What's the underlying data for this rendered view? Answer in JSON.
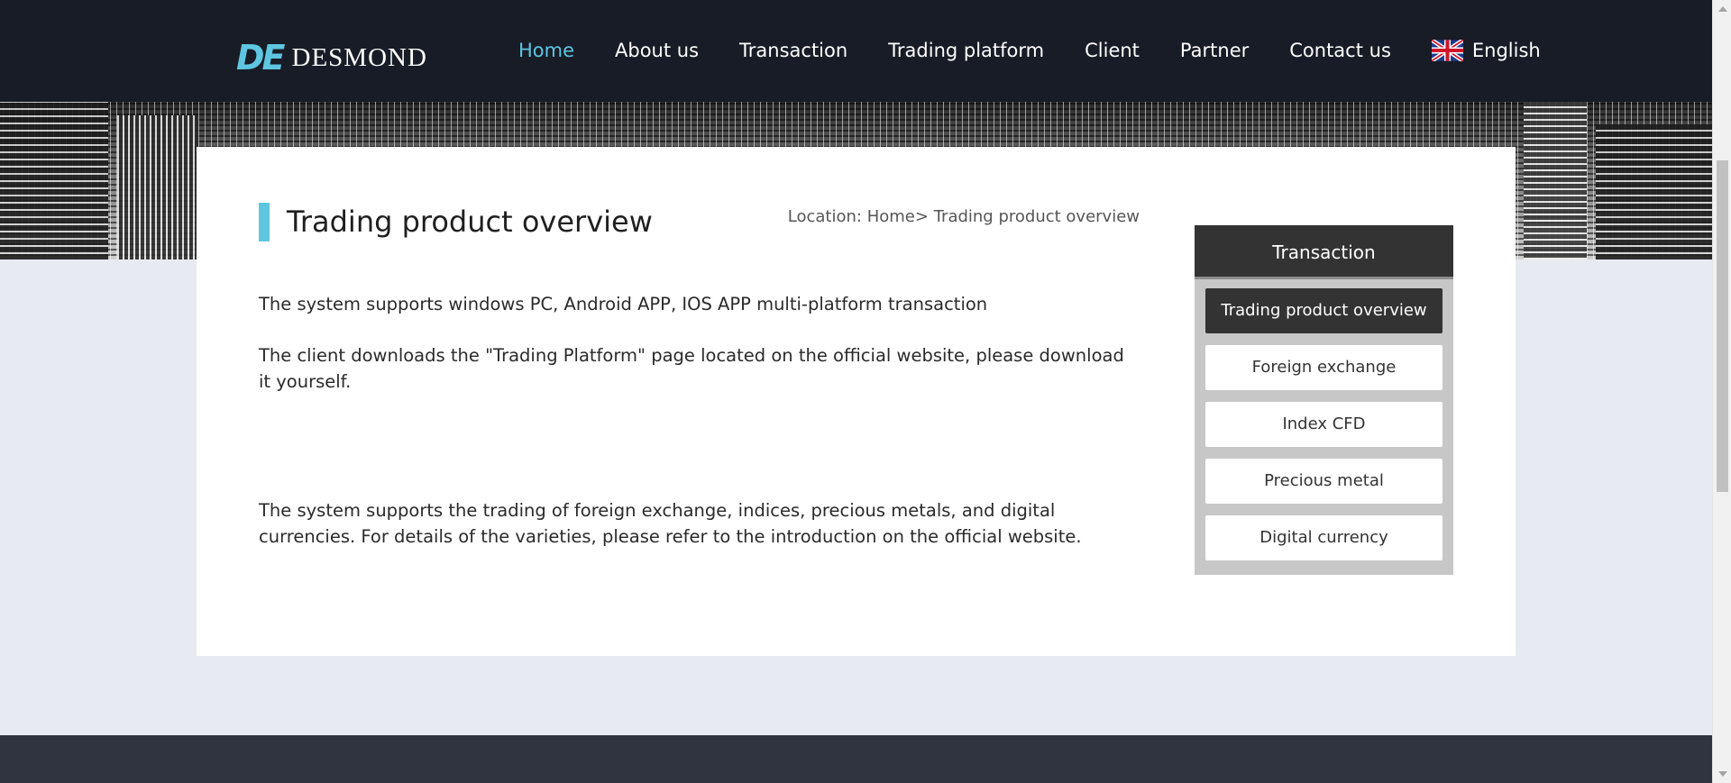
{
  "header": {
    "logo_mark": "DE",
    "logo_text": "DESMOND",
    "nav": [
      {
        "label": "Home",
        "active": true
      },
      {
        "label": "About us",
        "active": false
      },
      {
        "label": "Transaction",
        "active": false
      },
      {
        "label": "Trading platform",
        "active": false
      },
      {
        "label": "Client",
        "active": false
      },
      {
        "label": "Partner",
        "active": false
      },
      {
        "label": "Contact us",
        "active": false
      }
    ],
    "language": {
      "label": "English",
      "icon": "uk-flag-icon"
    }
  },
  "main": {
    "title": "Trading product overview",
    "location": {
      "prefix": "Location:",
      "home": "Home",
      "separator": ">",
      "current": " Trading product overview"
    },
    "paragraphs": [
      "The system supports windows PC, Android APP, IOS APP multi-platform transaction",
      "The client downloads the \"Trading Platform\" page located on the official website, please download it yourself.",
      "The system supports the trading of foreign exchange, indices, precious metals, and digital currencies. For details of the varieties, please refer to the introduction on the official website."
    ]
  },
  "sidebar": {
    "heading": "Transaction",
    "items": [
      {
        "label": "Trading product overview",
        "active": true
      },
      {
        "label": "Foreign exchange",
        "active": false
      },
      {
        "label": "Index CFD",
        "active": false
      },
      {
        "label": "Precious metal",
        "active": false
      },
      {
        "label": "Digital currency",
        "active": false
      }
    ]
  },
  "colors": {
    "header_bg": "#181c26",
    "accent": "#5ec6e0",
    "page_bg": "#e8eaf2",
    "sidebar_head_bg": "#333333",
    "footer_bg": "#2f3440"
  }
}
